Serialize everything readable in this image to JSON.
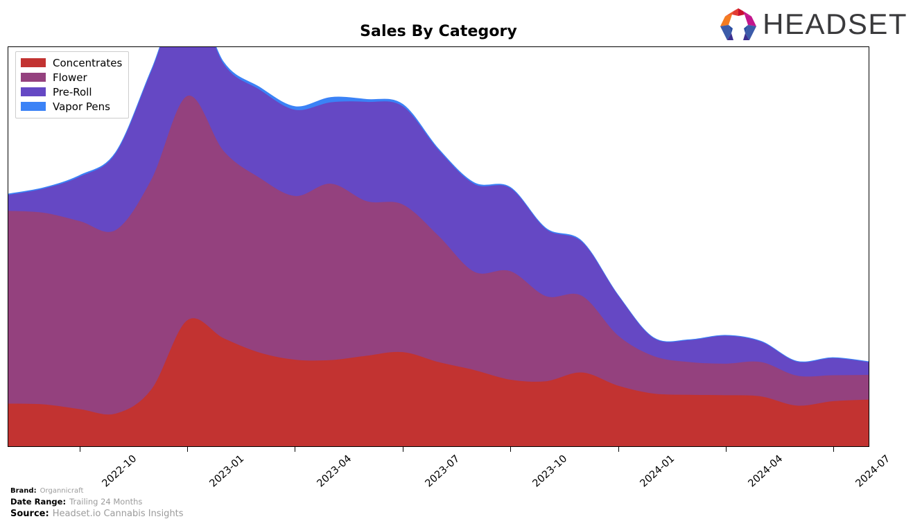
{
  "header": {
    "title": "Sales By Category",
    "logo_text": "HEADSET",
    "logo_colors": {
      "orange": "#F47B20",
      "red": "#E23B33",
      "crimson": "#C8102E",
      "magenta": "#C2168C",
      "blue": "#2B4FA2",
      "indigo": "#3B2E8F",
      "wordmark": "#3A3A3C"
    }
  },
  "legend": {
    "position": "upper-left",
    "items": [
      {
        "label": "Concentrates",
        "color": "#C23331"
      },
      {
        "label": "Flower",
        "color": "#94417E"
      },
      {
        "label": "Pre-Roll",
        "color": "#6548C4"
      },
      {
        "label": "Vapor Pens",
        "color": "#3B82F6"
      }
    ]
  },
  "chart_data": {
    "type": "area",
    "stacked": true,
    "title": "Sales By Category",
    "xlabel": "",
    "ylabel": "",
    "grid": false,
    "legend_position": "upper-left",
    "x": [
      "2022-08",
      "2022-09",
      "2022-10",
      "2022-11",
      "2022-12",
      "2023-01",
      "2023-02",
      "2023-03",
      "2023-04",
      "2023-05",
      "2023-06",
      "2023-07",
      "2023-08",
      "2023-09",
      "2023-10",
      "2023-11",
      "2023-12",
      "2024-01",
      "2024-02",
      "2024-03",
      "2024-04",
      "2024-05",
      "2024-06",
      "2024-07",
      "2024-08"
    ],
    "xtick_labels": [
      "2022-10",
      "2023-01",
      "2023-04",
      "2023-07",
      "2023-10",
      "2024-01",
      "2024-04",
      "2024-07"
    ],
    "xtick_positions": [
      2,
      5,
      8,
      11,
      14,
      17,
      20,
      23
    ],
    "ylim": [
      0,
      100
    ],
    "yaxis_visible": false,
    "series": [
      {
        "name": "Concentrates",
        "color": "#C23331",
        "values": [
          10.6,
          10.4,
          9.2,
          8.1,
          14.2,
          31.5,
          27.0,
          23.4,
          21.6,
          21.5,
          22.6,
          23.5,
          21.0,
          19.0,
          16.6,
          16.2,
          18.4,
          15.1,
          13.1,
          12.8,
          12.7,
          12.4,
          10.1,
          11.2,
          11.6
        ]
      },
      {
        "name": "Flower",
        "color": "#94417E",
        "values": [
          48.3,
          48.0,
          47.1,
          46.0,
          52.6,
          56.2,
          46.9,
          43.8,
          41.0,
          44.2,
          38.7,
          37.0,
          31.6,
          24.6,
          27.2,
          21.3,
          19.2,
          12.6,
          9.4,
          8.2,
          7.9,
          8.6,
          7.5,
          6.5,
          6.2
        ]
      },
      {
        "name": "Pre-Roll",
        "color": "#6548C4",
        "values": [
          4.0,
          6.1,
          11.2,
          19.2,
          27.2,
          27.3,
          21.8,
          22.1,
          21.6,
          20.4,
          24.9,
          24.6,
          21.5,
          22.0,
          20.8,
          16.8,
          13.5,
          10.1,
          4.5,
          5.5,
          7.0,
          5.1,
          3.5,
          4.3,
          3.2
        ]
      },
      {
        "name": "Vapor Pens",
        "color": "#3B82F6",
        "values": [
          0.3,
          0.3,
          0.4,
          0.4,
          0.5,
          0.5,
          0.6,
          0.7,
          0.9,
          1.3,
          0.7,
          0.6,
          0.4,
          0.4,
          0.3,
          0.3,
          0.3,
          0.2,
          0.2,
          0.2,
          0.2,
          0.2,
          0.2,
          0.2,
          0.2
        ]
      }
    ]
  },
  "footnotes": {
    "brand_key": "Brand:",
    "brand_value": "Organnicraft",
    "range_key": "Date Range:",
    "range_value": "Trailing 24 Months",
    "source_key": "Source:",
    "source_value": "Headset.io Cannabis Insights"
  }
}
